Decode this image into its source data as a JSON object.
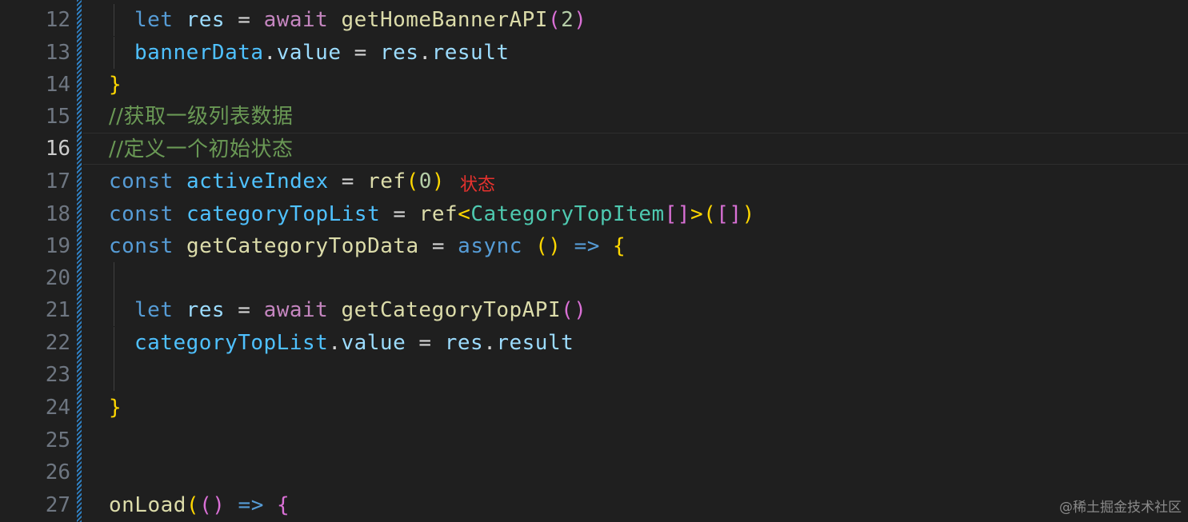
{
  "editor": {
    "lines": [
      {
        "number": "12",
        "indent": 1,
        "tokens": [
          {
            "t": "let",
            "c": "kw-blue"
          },
          {
            "t": " ",
            "c": "plain"
          },
          {
            "t": "res",
            "c": "var-lb"
          },
          {
            "t": " = ",
            "c": "plain"
          },
          {
            "t": "await",
            "c": "kw-pink"
          },
          {
            "t": " ",
            "c": "plain"
          },
          {
            "t": "getHomeBannerAPI",
            "c": "fn"
          },
          {
            "t": "(",
            "c": "br-pink"
          },
          {
            "t": "2",
            "c": "num"
          },
          {
            "t": ")",
            "c": "br-pink"
          }
        ]
      },
      {
        "number": "13",
        "indent": 1,
        "tokens": [
          {
            "t": "bannerData",
            "c": "var-blue"
          },
          {
            "t": ".",
            "c": "plain"
          },
          {
            "t": "value",
            "c": "var-lb"
          },
          {
            "t": " = ",
            "c": "plain"
          },
          {
            "t": "res",
            "c": "var-lb"
          },
          {
            "t": ".",
            "c": "plain"
          },
          {
            "t": "result",
            "c": "var-lb"
          }
        ]
      },
      {
        "number": "14",
        "indent": 0,
        "tokens": [
          {
            "t": "}",
            "c": "br-gold"
          }
        ]
      },
      {
        "number": "15",
        "indent": 0,
        "tokens": [
          {
            "t": "//获取一级列表数据",
            "c": "cmt"
          }
        ]
      },
      {
        "number": "16",
        "indent": 0,
        "current": true,
        "tokens": [
          {
            "t": "//定义一个初始状态",
            "c": "cmt"
          }
        ]
      },
      {
        "number": "17",
        "indent": 0,
        "tokens": [
          {
            "t": "const",
            "c": "kw-blue"
          },
          {
            "t": " ",
            "c": "plain"
          },
          {
            "t": "activeIndex",
            "c": "var-blue"
          },
          {
            "t": " = ",
            "c": "plain"
          },
          {
            "t": "ref",
            "c": "fn"
          },
          {
            "t": "(",
            "c": "br-gold"
          },
          {
            "t": "0",
            "c": "num"
          },
          {
            "t": ")",
            "c": "br-gold"
          }
        ]
      },
      {
        "number": "18",
        "indent": 0,
        "tokens": [
          {
            "t": "const",
            "c": "kw-blue"
          },
          {
            "t": " ",
            "c": "plain"
          },
          {
            "t": "categoryTopList",
            "c": "var-blue"
          },
          {
            "t": " = ",
            "c": "plain"
          },
          {
            "t": "ref",
            "c": "fn"
          },
          {
            "t": "<",
            "c": "br-gold"
          },
          {
            "t": "CategoryTopItem",
            "c": "type"
          },
          {
            "t": "[]",
            "c": "br-pink"
          },
          {
            "t": ">",
            "c": "br-gold"
          },
          {
            "t": "(",
            "c": "br-gold"
          },
          {
            "t": "[]",
            "c": "br-pink"
          },
          {
            "t": ")",
            "c": "br-gold"
          }
        ]
      },
      {
        "number": "19",
        "indent": 0,
        "tokens": [
          {
            "t": "const",
            "c": "kw-blue"
          },
          {
            "t": " ",
            "c": "plain"
          },
          {
            "t": "getCategoryTopData",
            "c": "fn"
          },
          {
            "t": " = ",
            "c": "plain"
          },
          {
            "t": "async",
            "c": "kw-blue"
          },
          {
            "t": " ",
            "c": "plain"
          },
          {
            "t": "()",
            "c": "br-gold"
          },
          {
            "t": " ",
            "c": "plain"
          },
          {
            "t": "=>",
            "c": "kw-blue"
          },
          {
            "t": " ",
            "c": "plain"
          },
          {
            "t": "{",
            "c": "br-gold"
          }
        ]
      },
      {
        "number": "20",
        "indent": 1,
        "tokens": []
      },
      {
        "number": "21",
        "indent": 1,
        "tokens": [
          {
            "t": "let",
            "c": "kw-blue"
          },
          {
            "t": " ",
            "c": "plain"
          },
          {
            "t": "res",
            "c": "var-lb"
          },
          {
            "t": " = ",
            "c": "plain"
          },
          {
            "t": "await",
            "c": "kw-pink"
          },
          {
            "t": " ",
            "c": "plain"
          },
          {
            "t": "getCategoryTopAPI",
            "c": "fn"
          },
          {
            "t": "()",
            "c": "br-pink"
          }
        ]
      },
      {
        "number": "22",
        "indent": 1,
        "tokens": [
          {
            "t": "categoryTopList",
            "c": "var-blue"
          },
          {
            "t": ".",
            "c": "plain"
          },
          {
            "t": "value",
            "c": "var-lb"
          },
          {
            "t": " = ",
            "c": "plain"
          },
          {
            "t": "res",
            "c": "var-lb"
          },
          {
            "t": ".",
            "c": "plain"
          },
          {
            "t": "result",
            "c": "var-lb"
          }
        ]
      },
      {
        "number": "23",
        "indent": 1,
        "tokens": []
      },
      {
        "number": "24",
        "indent": 0,
        "tokens": [
          {
            "t": "}",
            "c": "br-gold"
          }
        ]
      },
      {
        "number": "25",
        "indent": 0,
        "tokens": []
      },
      {
        "number": "26",
        "indent": 0,
        "tokens": []
      },
      {
        "number": "27",
        "indent": 0,
        "tokens": [
          {
            "t": "onLoad",
            "c": "fn"
          },
          {
            "t": "(",
            "c": "br-gold"
          },
          {
            "t": "()",
            "c": "br-pink"
          },
          {
            "t": " ",
            "c": "plain"
          },
          {
            "t": "=>",
            "c": "kw-blue"
          },
          {
            "t": " ",
            "c": "plain"
          },
          {
            "t": "{",
            "c": "br-pink"
          }
        ]
      }
    ]
  },
  "annotation": {
    "text": "状态",
    "color": "#e8322e"
  },
  "watermark": {
    "text": "@稀土掘金技术社区"
  },
  "colors": {
    "background": "#1f1f1f",
    "diff_bar": "#2f7fc1"
  }
}
